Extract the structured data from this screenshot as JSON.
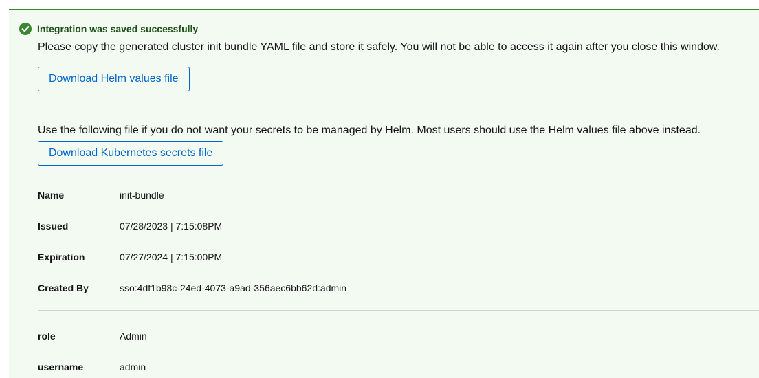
{
  "alert": {
    "title": "Integration was saved successfully",
    "message": "Please copy the generated cluster init bundle YAML file and store it safely. You will not be able to access it again after you close this window.",
    "helm_button": "Download Helm values file",
    "secrets_note": "Use the following file if you do not want your secrets to be managed by Helm. Most users should use the Helm values file above instead.",
    "secrets_button": "Download Kubernetes secrets file",
    "status_color": "#3e8635"
  },
  "details": [
    {
      "term": "Name",
      "value": "init-bundle"
    },
    {
      "term": "Issued",
      "value": "07/28/2023 | 7:15:08PM"
    },
    {
      "term": "Expiration",
      "value": "07/27/2024 | 7:15:00PM"
    },
    {
      "term": "Created By",
      "value": "sso:4df1b98c-24ed-4073-a9ad-356aec6bb62d:admin"
    }
  ],
  "attributes": [
    {
      "term": "role",
      "value": "Admin"
    },
    {
      "term": "username",
      "value": "admin"
    }
  ]
}
